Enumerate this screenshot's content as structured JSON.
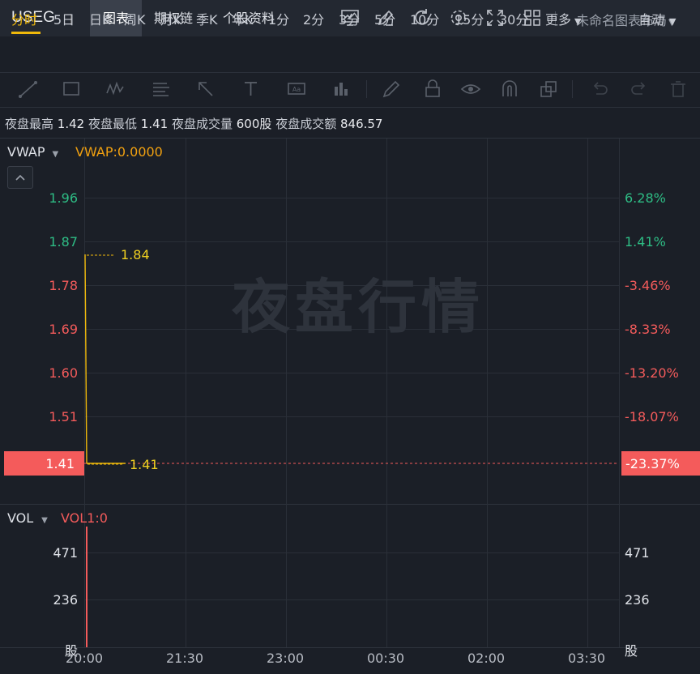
{
  "header": {
    "symbol": "USEG",
    "tabs": [
      "图表",
      "期权链",
      "个股资料"
    ],
    "active_tab": "图表",
    "layout_label": "未命名图表布局",
    "icons": [
      "chart-icon",
      "pencil-icon",
      "refresh-icon",
      "settings-icon",
      "fullscreen-icon",
      "grid-icon"
    ]
  },
  "periods": {
    "items": [
      "分时",
      "5日",
      "日K",
      "周K",
      "月K",
      "季K",
      "年K",
      "1分",
      "2分",
      "3分",
      "5分",
      "10分",
      "15分",
      "30分",
      "更多"
    ],
    "active": "分时",
    "mode": "自动"
  },
  "toolbar": {
    "icons": [
      "line-tool-icon",
      "rect-tool-icon",
      "wave-tool-icon",
      "fib-tool-icon",
      "arrow-tool-icon",
      "text-tool-icon",
      "label-tool-icon",
      "bar-tool-icon",
      "brush-icon",
      "lock-icon",
      "eye-icon",
      "magnet-icon",
      "layers-icon",
      "undo-icon",
      "redo-icon",
      "trash-icon"
    ]
  },
  "info": {
    "high_label": "夜盘最高",
    "high": "1.42",
    "low_label": "夜盘最低",
    "low": "1.41",
    "vol_label": "夜盘成交量",
    "vol": "600股",
    "amt_label": "夜盘成交额",
    "amt": "846.57"
  },
  "price_panel": {
    "indicator": "VWAP",
    "indicator_value": "VWAP:0.0000",
    "watermark": "夜盘行情",
    "left_axis": [
      "1.96",
      "1.87",
      "1.78",
      "1.69",
      "1.60",
      "1.51"
    ],
    "right_axis": [
      "6.28%",
      "1.41%",
      "-3.46%",
      "-8.33%",
      "-13.20%",
      "-18.07%"
    ],
    "current_price": "1.41",
    "current_pct": "-23.37%",
    "high_marker": "1.84",
    "low_marker": "1.41"
  },
  "volume_panel": {
    "indicator": "VOL",
    "indicator_value": "VOL1:0",
    "left_axis": [
      "471",
      "236",
      "股"
    ],
    "right_axis": [
      "471",
      "236",
      "股"
    ]
  },
  "chart_data": {
    "type": "line",
    "x_ticks": [
      "20:00",
      "21:30",
      "23:00",
      "00:30",
      "02:00",
      "03:30"
    ],
    "price": {
      "open": 1.84,
      "last": 1.41,
      "high": 1.84,
      "low": 1.41
    },
    "ylim": [
      1.41,
      1.96
    ],
    "volume": {
      "max": 471
    }
  },
  "colors": {
    "accent": "#f0b90b",
    "up": "#2ebd85",
    "down": "#f45b5b"
  }
}
